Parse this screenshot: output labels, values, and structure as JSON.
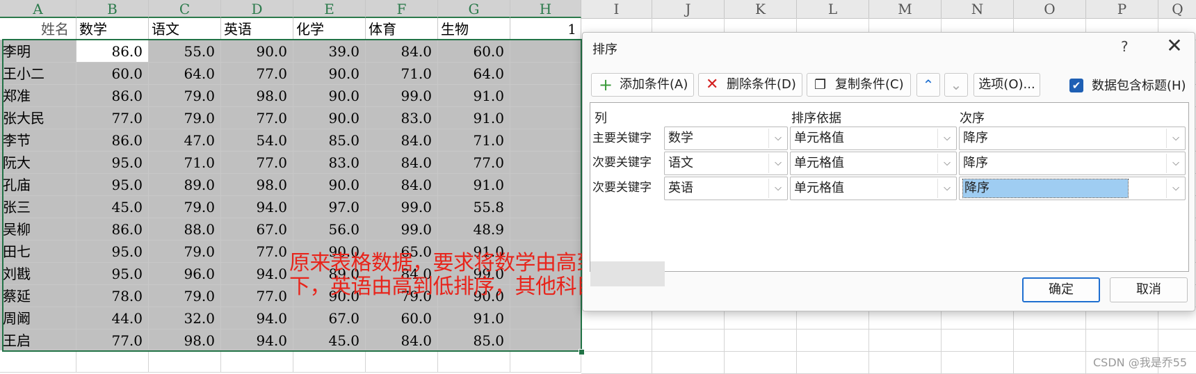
{
  "columns": [
    "A",
    "B",
    "C",
    "D",
    "E",
    "F",
    "G",
    "H",
    "I",
    "J",
    "K",
    "L",
    "M",
    "N",
    "O",
    "P",
    "Q"
  ],
  "sheet": {
    "headers": [
      "姓名",
      "数学",
      "语文",
      "英语",
      "化学",
      "体育",
      "生物"
    ],
    "h1_value": "1",
    "rows": [
      [
        "李明",
        "86.0",
        "55.0",
        "90.0",
        "39.0",
        "84.0",
        "60.0"
      ],
      [
        "王小二",
        "60.0",
        "64.0",
        "77.0",
        "90.0",
        "71.0",
        "64.0"
      ],
      [
        "郑准",
        "86.0",
        "79.0",
        "98.0",
        "90.0",
        "99.0",
        "91.0"
      ],
      [
        "张大民",
        "77.0",
        "79.0",
        "77.0",
        "90.0",
        "83.0",
        "91.0"
      ],
      [
        "李节",
        "86.0",
        "47.0",
        "54.0",
        "85.0",
        "84.0",
        "71.0"
      ],
      [
        "阮大",
        "95.0",
        "71.0",
        "77.0",
        "83.0",
        "84.0",
        "77.0"
      ],
      [
        "孔庙",
        "95.0",
        "89.0",
        "98.0",
        "90.0",
        "84.0",
        "91.0"
      ],
      [
        "张三",
        "45.0",
        "79.0",
        "94.0",
        "97.0",
        "99.0",
        "55.8"
      ],
      [
        "吴柳",
        "86.0",
        "88.0",
        "67.0",
        "56.0",
        "99.0",
        "48.9"
      ],
      [
        "田七",
        "95.0",
        "79.0",
        "77.0",
        "90.0",
        "65.0",
        "91.0"
      ],
      [
        "刘戡",
        "95.0",
        "96.0",
        "94.0",
        "89.0",
        "84.0",
        "99.0"
      ],
      [
        "蔡延",
        "78.0",
        "79.0",
        "77.0",
        "90.0",
        "79.0",
        "90.0"
      ],
      [
        "周阚",
        "44.0",
        "32.0",
        "94.0",
        "67.0",
        "60.0",
        "91.0"
      ],
      [
        "王启",
        "77.0",
        "98.0",
        "94.0",
        "45.0",
        "84.0",
        "85.0"
      ]
    ]
  },
  "annotation": {
    "line1": "原来表格数据，要求将数学由高到低排序，数学相同情况下，语文由高到低排序，语文相同情况",
    "line2": "下，英语由高到低排序，其他科目则无要求"
  },
  "dialog": {
    "title": "排序",
    "help": "?",
    "close": "✕",
    "toolbar": {
      "add": "添加条件(A)",
      "delete": "删除条件(D)",
      "copy": "复制条件(C)",
      "up": "⌃",
      "down": "⌄",
      "options": "选项(O)...",
      "has_header_label": "数据包含标题(H)"
    },
    "grid_headers": {
      "column": "列",
      "sort_on": "排序依据",
      "order": "次序"
    },
    "levels": [
      {
        "label": "主要关键字",
        "column": "数学",
        "sort_on": "单元格值",
        "order": "降序"
      },
      {
        "label": "次要关键字",
        "column": "语文",
        "sort_on": "单元格值",
        "order": "降序"
      },
      {
        "label": "次要关键字",
        "column": "英语",
        "sort_on": "单元格值",
        "order": "降序"
      }
    ],
    "ok": "确定",
    "cancel": "取消"
  },
  "watermark": "CSDN @我是乔55",
  "colors": {
    "selection": "#217346",
    "annotation": "#e8241b",
    "accent": "#1f6fd0"
  }
}
